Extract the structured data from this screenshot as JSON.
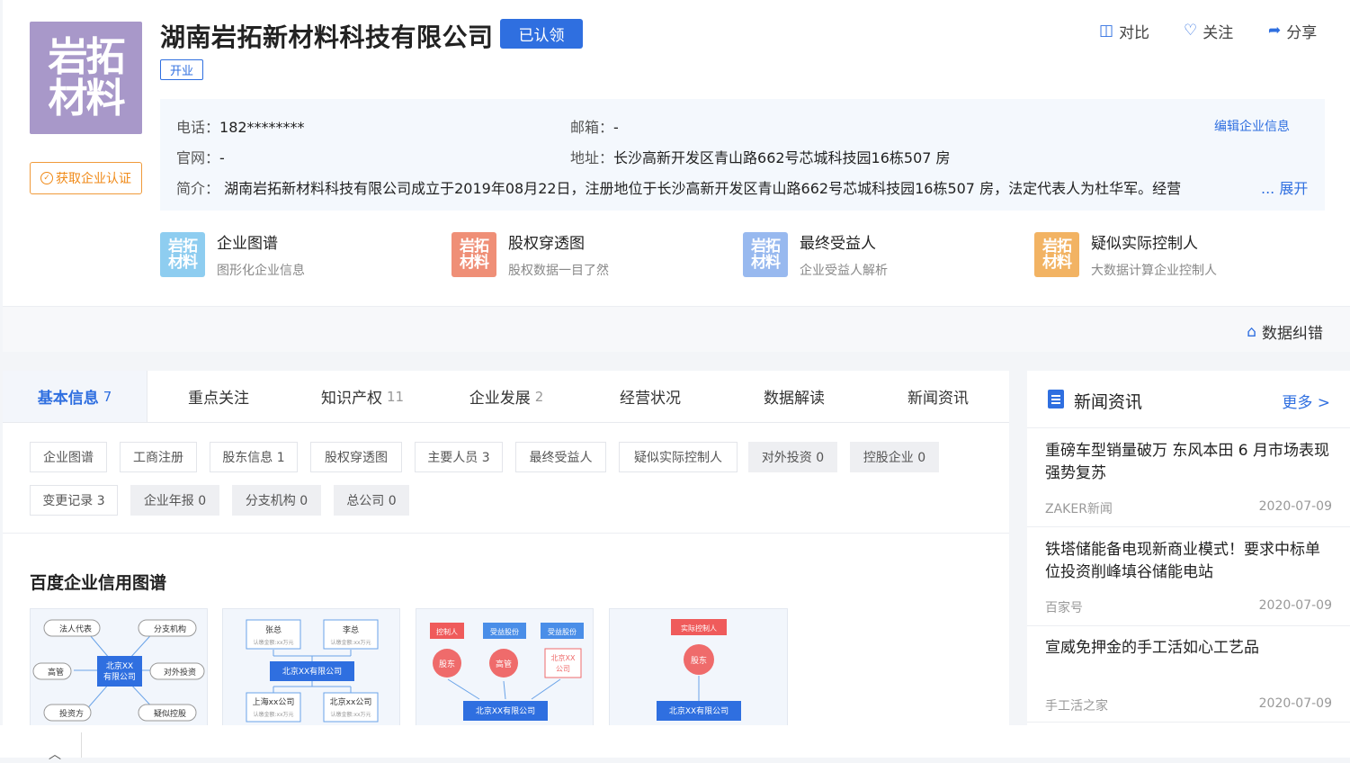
{
  "company": {
    "logo_line1": "岩拓",
    "logo_line2": "材料",
    "name": "湖南岩拓新材料科技有限公司",
    "claimed_label": "已认领",
    "status": "开业",
    "cert_label": "获取企业认证"
  },
  "actions": {
    "compare": "对比",
    "follow": "关注",
    "share": "分享"
  },
  "info": {
    "phone_label": "电话：",
    "phone_value": "182********",
    "email_label": "邮箱：",
    "email_value": "-",
    "site_label": "官网：",
    "site_value": "-",
    "address_label": "地址：",
    "address_value": "长沙高新开发区青山路662号芯城科技园16栋507 房",
    "intro_label": "简介：",
    "intro_value": "湖南岩拓新材料科技有限公司成立于2019年08月22日，注册地位于长沙高新开发区青山路662号芯城科技园16栋507 房，法定代表人为杜华军。经营",
    "expand": "... 展开",
    "edit": "编辑企业信息"
  },
  "features": [
    {
      "title": "企业图谱",
      "subtitle": "图形化企业信息",
      "color": "#8ecdf0"
    },
    {
      "title": "股权穿透图",
      "subtitle": "股权数据一目了然",
      "color": "#ef8f77"
    },
    {
      "title": "最终受益人",
      "subtitle": "企业受益人解析",
      "color": "#98b9ef"
    },
    {
      "title": "疑似实际控制人",
      "subtitle": "大数据计算企业控制人",
      "color": "#f2b363"
    }
  ],
  "data_fix": "数据纠错",
  "tabs": [
    {
      "label": "基本信息",
      "count": "7"
    },
    {
      "label": "重点关注",
      "count": ""
    },
    {
      "label": "知识产权",
      "count": "11"
    },
    {
      "label": "企业发展",
      "count": "2"
    },
    {
      "label": "经营状况",
      "count": ""
    },
    {
      "label": "数据解读",
      "count": ""
    },
    {
      "label": "新闻资讯",
      "count": ""
    }
  ],
  "chips": [
    "企业图谱",
    "工商注册",
    "股东信息 1",
    "股权穿透图",
    "主要人员 3",
    "最终受益人",
    "疑似实际控制人",
    "对外投资 0",
    "控股企业 0",
    "变更记录 3",
    "企业年报 0",
    "分支机构 0",
    "总公司 0"
  ],
  "credit_section_title": "百度企业信用图谱",
  "thumbs": {
    "t1": {
      "center": "北京XX\n有限公司",
      "n1": "法人代表",
      "n2": "分支机构",
      "n3": "高管",
      "n4": "对外投资",
      "n5": "投资方",
      "n6": "疑似控股"
    },
    "t2": {
      "a": "张总",
      "b": "李总",
      "sub": "认缴金额:xx万元",
      "center": "北京XX有限公司",
      "c": "上海xx公司",
      "d": "北京xx公司"
    },
    "t3": {
      "tag1": "控制人",
      "tag2": "受益股份",
      "tag3": "受益股份",
      "c1": "股东",
      "c2": "高管",
      "c3a": "北京XX",
      "c3b": "公司",
      "bottom": "北京XX有限公司"
    },
    "t4": {
      "tag": "实际控制人",
      "c": "股东",
      "bottom": "北京XX有限公司"
    }
  },
  "news": {
    "title": "新闻资讯",
    "more": "更多 >",
    "items": [
      {
        "title": "重磅车型销量破万 东风本田 6 月市场表现强势复苏",
        "source": "ZAKER新闻",
        "date": "2020-07-09"
      },
      {
        "title": "铁塔储能备电现新商业模式！要求中标单位投资削峰填谷储能电站",
        "source": "百家号",
        "date": "2020-07-09"
      },
      {
        "title": "宣威免押金的手工活如心工艺品",
        "source": "手工活之家",
        "date": "2020-07-09"
      }
    ]
  },
  "scroll_top": "︿"
}
